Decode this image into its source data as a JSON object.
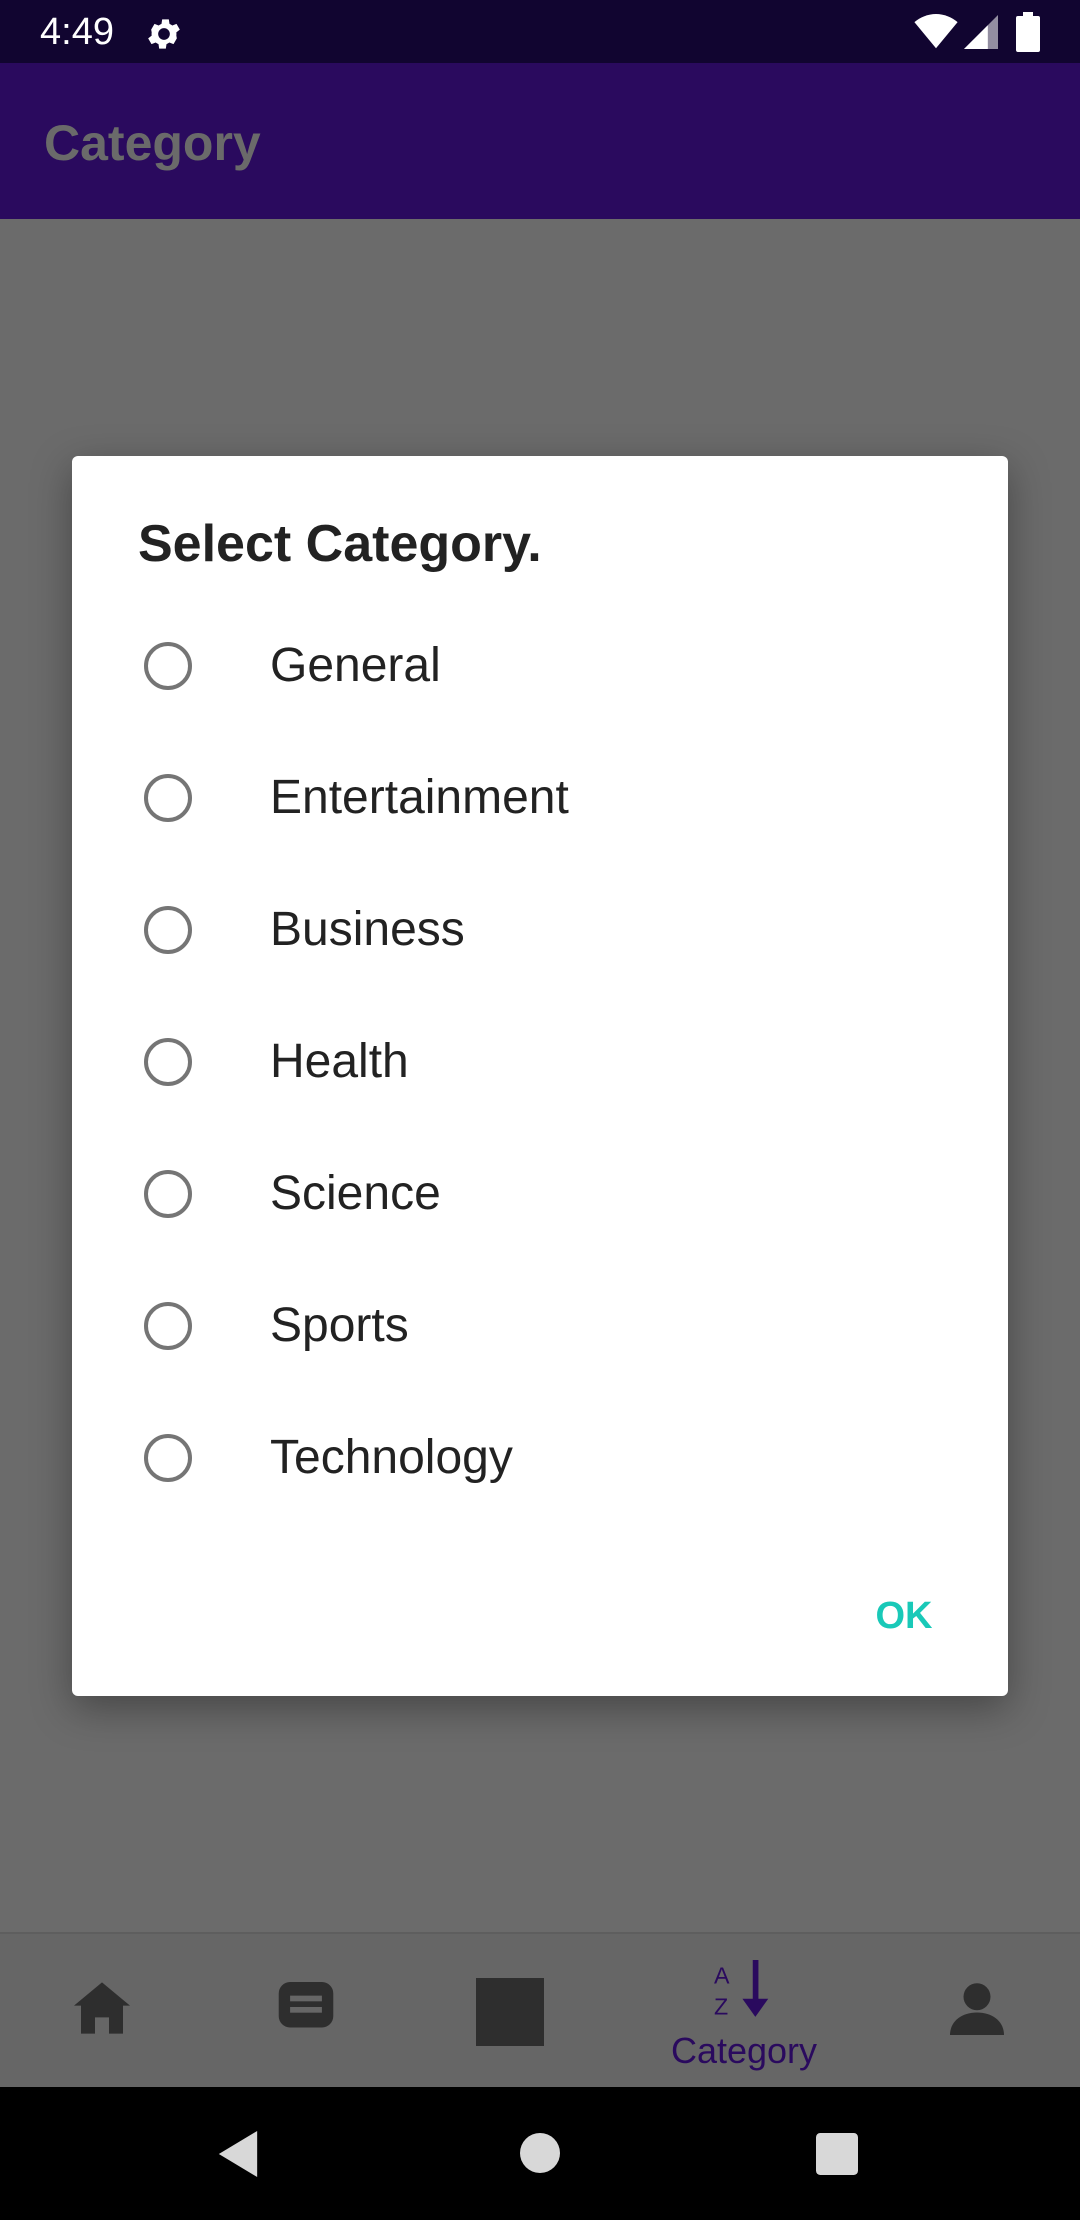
{
  "status_bar": {
    "time": "4:49",
    "icons": [
      "settings-gear-icon",
      "wifi-icon",
      "signal-icon",
      "battery-icon"
    ]
  },
  "app_bar": {
    "title": "Category"
  },
  "dialog": {
    "title": "Select Category.",
    "options": [
      {
        "label": "General",
        "selected": false
      },
      {
        "label": "Entertainment",
        "selected": false
      },
      {
        "label": "Business",
        "selected": false
      },
      {
        "label": "Health",
        "selected": false
      },
      {
        "label": "Science",
        "selected": false
      },
      {
        "label": "Sports",
        "selected": false
      },
      {
        "label": "Technology",
        "selected": false
      }
    ],
    "ok_label": "OK"
  },
  "bottom_nav": {
    "items": [
      {
        "icon": "home-icon"
      },
      {
        "icon": "chat-icon"
      },
      {
        "icon": "square-icon"
      },
      {
        "icon": "sort-az-icon",
        "label": "Category",
        "active": true
      },
      {
        "icon": "person-icon"
      }
    ]
  },
  "system_nav": {
    "icons": [
      "back-icon",
      "home-circle-icon",
      "recents-icon"
    ]
  },
  "colors": {
    "status_bar": "#110530",
    "app_bar": "#2a0a5e",
    "accent": "#19c9b8",
    "scrim": "#6b6b6b",
    "nav_active": "#2a0a5e"
  }
}
